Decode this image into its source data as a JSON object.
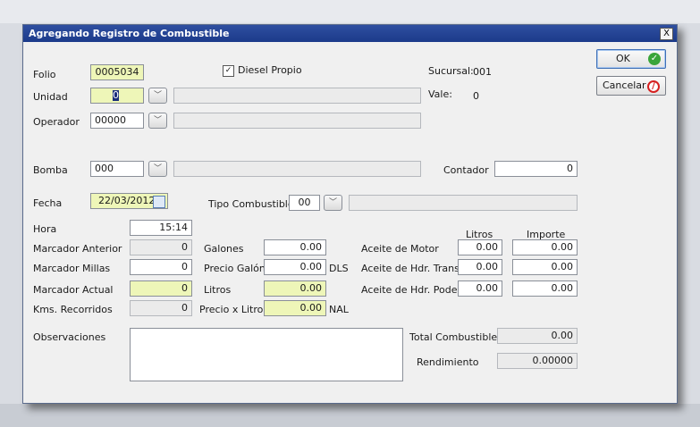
{
  "window": {
    "title": "Agregando Registro de Combustible",
    "close_glyph": "X"
  },
  "buttons": {
    "ok_label": "OK",
    "cancel_label": "Cancelar",
    "ok_icon": "check-icon",
    "cancel_icon": "cancel-icon"
  },
  "header": {
    "folio_label": "Folio",
    "folio_value": "0005034",
    "unidad_label": "Unidad",
    "unidad_value": "0",
    "operador_label": "Operador",
    "operador_value": "00000",
    "diesel_propio_label": "Diesel Propio",
    "diesel_propio_checked": true,
    "sucursal_label": "Sucursal:",
    "sucursal_value": "001",
    "vale_label": "Vale:",
    "vale_value": "0"
  },
  "pump": {
    "bomba_label": "Bomba",
    "bomba_value": "000",
    "contador_label": "Contador",
    "contador_value": "0"
  },
  "date": {
    "fecha_label": "Fecha",
    "fecha_value": "22/03/2012",
    "tipo_label": "Tipo Combustible",
    "tipo_value": "00",
    "hora_label": "Hora",
    "hora_value": "15:14"
  },
  "markers": {
    "anterior_label": "Marcador Anterior",
    "anterior_value": "0",
    "millas_label": "Marcador Millas",
    "millas_value": "0",
    "actual_label": "Marcador Actual",
    "actual_value": "0",
    "kms_label": "Kms. Recorridos",
    "kms_value": "0"
  },
  "fuel": {
    "galones_label": "Galones",
    "galones_value": "0.00",
    "precio_galon_label": "Precio Galón",
    "precio_galon_value": "0.00",
    "precio_galon_unit": "DLS",
    "litros_label": "Litros",
    "litros_value": "0.00",
    "precio_litro_label": "Precio x Litro",
    "precio_litro_value": "0.00",
    "precio_litro_unit": "NAL"
  },
  "oils": {
    "col_litros": "Litros",
    "col_importe": "Importe",
    "rows": [
      {
        "label": "Aceite de Motor",
        "litros": "0.00",
        "importe": "0.00"
      },
      {
        "label": "Aceite de Hdr. Trans.",
        "litros": "0.00",
        "importe": "0.00"
      },
      {
        "label": "Aceite de Hdr. Poder",
        "litros": "0.00",
        "importe": "0.00"
      }
    ]
  },
  "footer": {
    "observaciones_label": "Observaciones",
    "observaciones_value": "",
    "total_label": "Total Combustible",
    "total_value": "0.00",
    "rendimiento_label": "Rendimiento",
    "rendimiento_value": "0.00000"
  }
}
